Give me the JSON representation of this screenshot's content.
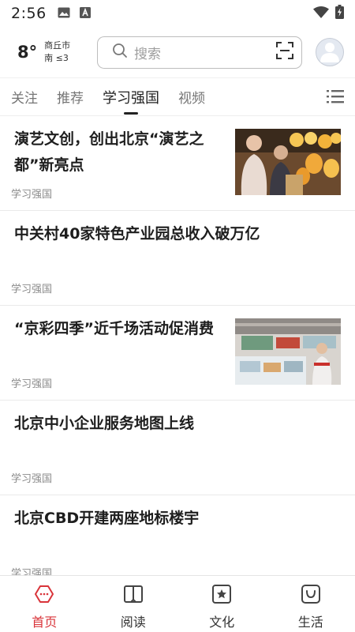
{
  "status_bar": {
    "time": "2:56",
    "icons": [
      "image-icon",
      "text-a-icon",
      "wifi-icon",
      "battery-charging-icon"
    ]
  },
  "header": {
    "temperature": "8°",
    "city": "商丘市",
    "wind": "南 ≤3",
    "search_placeholder": "搜索",
    "icons": [
      "search-icon",
      "scan-icon",
      "avatar-icon"
    ]
  },
  "tabs": {
    "items": [
      {
        "label": "关注"
      },
      {
        "label": "推荐"
      },
      {
        "label": "学习强国",
        "active": true
      },
      {
        "label": "视频"
      }
    ],
    "menu_icon": "list-menu-icon"
  },
  "articles": [
    {
      "title_line1": "演艺文创，创出北京“演艺之",
      "title_line2": "都”新亮点",
      "source": "学习强国",
      "has_image": true,
      "image": "lantern-market-photo"
    },
    {
      "title_line1": "中关村40家特色产业园总收入破万亿",
      "source": "学习强国",
      "has_image": false
    },
    {
      "title_line1": "“京彩四季”近千场活动促消费",
      "source": "学习强国",
      "has_image": true,
      "image": "supermarket-photo"
    },
    {
      "title_line1": "北京中小企业服务地图上线",
      "source": "学习强国",
      "has_image": false
    },
    {
      "title_line1": "北京CBD开建两座地标楼宇",
      "source": "学习强国",
      "has_image": false
    }
  ],
  "bottom_nav": {
    "items": [
      {
        "label": "首页",
        "icon": "home-icon",
        "active": true
      },
      {
        "label": "阅读",
        "icon": "book-icon"
      },
      {
        "label": "文化",
        "icon": "culture-star-icon"
      },
      {
        "label": "生活",
        "icon": "life-bag-icon"
      }
    ],
    "active_color": "#d9343a"
  }
}
